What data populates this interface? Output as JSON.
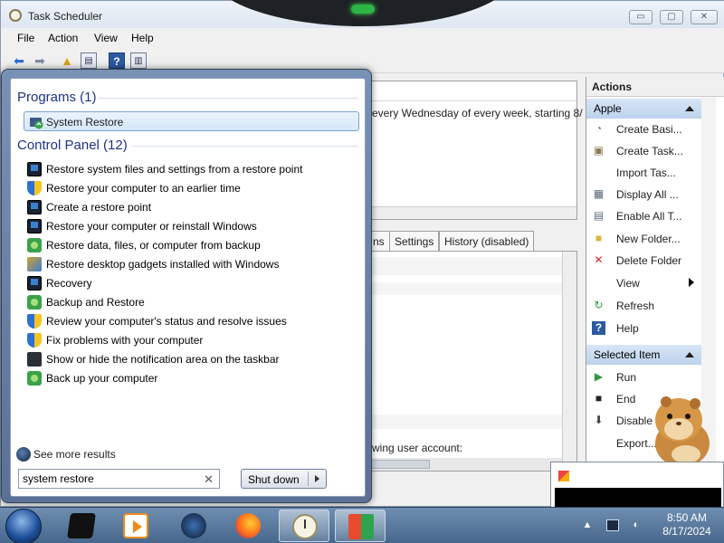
{
  "window": {
    "title": "Task Scheduler",
    "buttons": {
      "minimize": "▭",
      "maximize": "▢",
      "close": "✕"
    }
  },
  "menu": [
    "File",
    "Action",
    "View",
    "Help"
  ],
  "center": {
    "trigger_text": "every Wednesday of every week, starting 8/",
    "tabs": [
      "ns",
      "Settings",
      "History (disabled)"
    ],
    "account_text": "wing user account:"
  },
  "actions": {
    "title": "Actions",
    "groups": [
      {
        "label": "Apple",
        "items": [
          {
            "label": "Create Basi...",
            "icon": "create-basic-task-icon"
          },
          {
            "label": "Create Task...",
            "icon": "create-task-icon"
          },
          {
            "label": "Import Tas...",
            "icon": ""
          },
          {
            "label": "Display All ...",
            "icon": "display-all-icon"
          },
          {
            "label": "Enable All T...",
            "icon": "enable-all-icon"
          },
          {
            "label": "New Folder...",
            "icon": "folder-icon"
          },
          {
            "label": "Delete Folder",
            "icon": "delete-x-icon"
          },
          {
            "label": "View",
            "icon": ""
          },
          {
            "label": "Refresh",
            "icon": "refresh-icon"
          },
          {
            "label": "Help",
            "icon": "help-icon"
          }
        ]
      },
      {
        "label": "Selected Item",
        "items": [
          {
            "label": "Run",
            "icon": "run-icon"
          },
          {
            "label": "End",
            "icon": "end-icon"
          },
          {
            "label": "Disable",
            "icon": "disable-icon"
          },
          {
            "label": "Export...",
            "icon": ""
          }
        ]
      }
    ]
  },
  "start_menu": {
    "programs_header": "Programs (1)",
    "program": "System Restore",
    "control_panel_header": "Control Panel (12)",
    "control_panel_items": [
      {
        "label": "Restore system files and settings from a restore point",
        "icon": "monitor"
      },
      {
        "label": "Restore your computer to an earlier time",
        "icon": "shield"
      },
      {
        "label": "Create a restore point",
        "icon": "monitor"
      },
      {
        "label": "Restore your computer or reinstall Windows",
        "icon": "monitor"
      },
      {
        "label": "Restore data, files, or computer from backup",
        "icon": "green"
      },
      {
        "label": "Restore desktop gadgets installed with Windows",
        "icon": "gadget"
      },
      {
        "label": "Recovery",
        "icon": "monitor"
      },
      {
        "label": "Backup and Restore",
        "icon": "green"
      },
      {
        "label": "Review your computer's status and resolve issues",
        "icon": "shield"
      },
      {
        "label": "Fix problems with your computer",
        "icon": "shield"
      },
      {
        "label": "Show or hide the notification area on the taskbar",
        "icon": "laptop"
      },
      {
        "label": "Back up your computer",
        "icon": "green"
      }
    ],
    "see_more": "See more results",
    "search_value": "system restore",
    "shutdown_label": "Shut down"
  },
  "taskbar": {
    "apps": [
      "explorer",
      "media-player",
      "network",
      "firefox",
      "task-scheduler",
      "windows-explorer"
    ],
    "time": "8:50 AM",
    "date": "8/17/2024"
  }
}
